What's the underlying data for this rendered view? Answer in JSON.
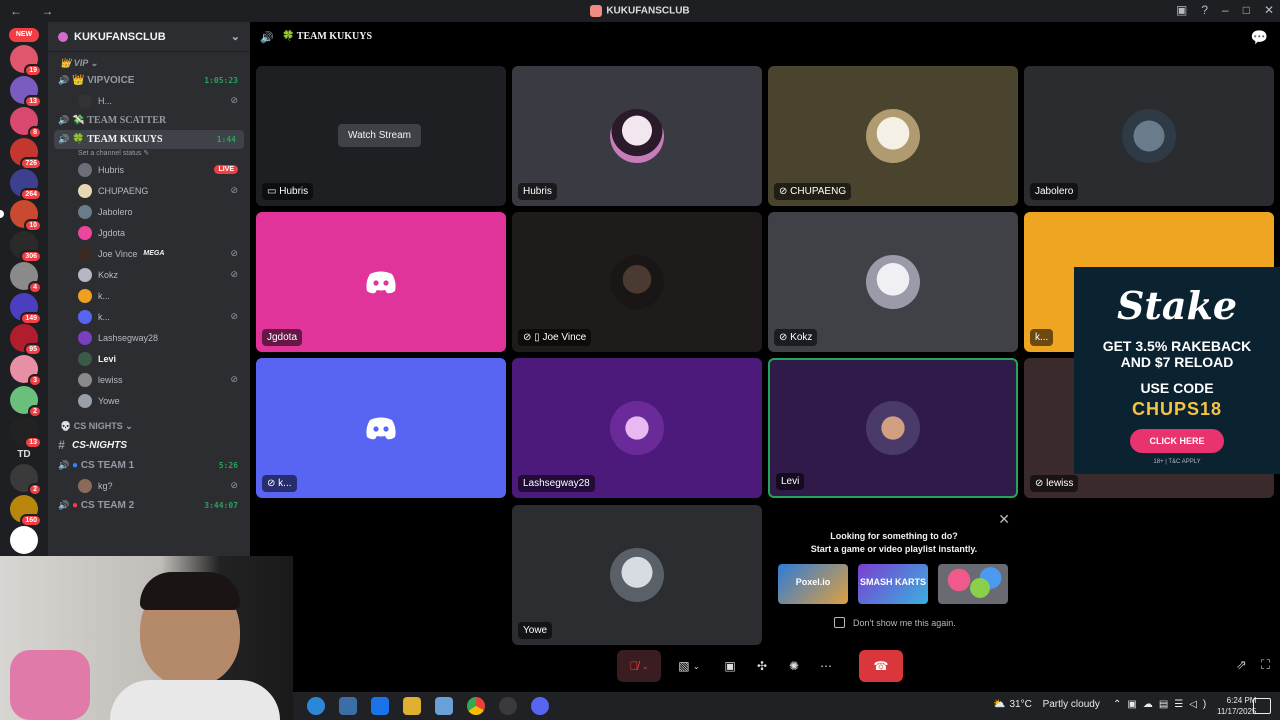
{
  "titlebar": {
    "title": "KUKUFANSCLUB",
    "nav": "←  →"
  },
  "guilds": [
    {
      "badge": "19",
      "color": "#e0566b"
    },
    {
      "badge": "13",
      "color": "#7a5cc0"
    },
    {
      "badge": "8",
      "color": "#d9486e"
    },
    {
      "badge": "726",
      "color": "#c4372f"
    },
    {
      "badge": "264",
      "color": "#3d3f8f"
    },
    {
      "badge": "10",
      "color": "#c94a2e"
    },
    {
      "badge": "306",
      "color": "#2a2a2a"
    },
    {
      "badge": "4",
      "color": "#8a8a8a"
    },
    {
      "badge": "149",
      "color": "#4b3fbf"
    },
    {
      "badge": "95",
      "color": "#b01e2e"
    },
    {
      "badge": "3",
      "color": "#e88fa6"
    },
    {
      "badge": "2",
      "color": "#6ac07a"
    },
    {
      "badge": "13",
      "color": "#222222"
    },
    {
      "badge": "2",
      "color": "#3a3a3a"
    },
    {
      "badge": "160",
      "color": "#b8860b"
    },
    {
      "badge": "",
      "color": "#ffffff"
    }
  ],
  "guild_new_label": "NEW",
  "guild_td_label": "TD",
  "server": {
    "name": "KUKUFANSCLUB"
  },
  "categories": {
    "vip": "VIP",
    "csnights": "CS NIGHTS",
    "csnights_channel": "CS-NIGHTS"
  },
  "channels": {
    "vipvoice": {
      "name": "VIPVOICE",
      "time": "1:05:23",
      "user": "H..."
    },
    "scatter": {
      "name": "TEAM SCATTER"
    },
    "kukuys": {
      "name": "TEAM KUKUYS",
      "time": "1:44",
      "status_hint": "Set a channel status"
    },
    "csteam1": {
      "name": "CS TEAM 1",
      "time": "5:26",
      "user": "kg?"
    },
    "csteam2": {
      "name": "CS TEAM 2",
      "time": "3:44:07"
    }
  },
  "members": [
    {
      "name": "Hubris",
      "live": "LIVE",
      "color": "#6d6f78"
    },
    {
      "name": "CHUPAENG",
      "color": "#e8d8b0"
    },
    {
      "name": "Jabolero",
      "color": "#6b7b8a"
    },
    {
      "name": "Jgdota",
      "color": "#eb459e"
    },
    {
      "name": "Joe Vince",
      "tag": "MEGA",
      "color": "#3a2a22"
    },
    {
      "name": "Kokz",
      "color": "#b7b7c4"
    },
    {
      "name": "k...",
      "color": "#f0a020"
    },
    {
      "name": "k...",
      "color": "#5865f2"
    },
    {
      "name": "Lashsegway28",
      "color": "#7a3fbf"
    },
    {
      "name": "Levi",
      "color": "#3a5a4a"
    },
    {
      "name": "lewiss",
      "color": "#8a8a8a"
    },
    {
      "name": "Yowe",
      "color": "#9aa0a8"
    }
  ],
  "header": {
    "channel": "TEAM KUKUYS"
  },
  "tiles": {
    "hubris_stream": {
      "label": "Hubris",
      "watch": "Watch Stream"
    },
    "hubris": {
      "label": "Hubris"
    },
    "chupaeng": {
      "label": "CHUPAENG"
    },
    "jabolero": {
      "label": "Jabolero"
    },
    "jgdota": {
      "label": "Jgdota"
    },
    "joevince": {
      "label": "Joe Vince"
    },
    "kokz": {
      "label": "Kokz"
    },
    "k_orange": {
      "label": "k..."
    },
    "k_blue": {
      "label": "k..."
    },
    "lashsegway": {
      "label": "Lashsegway28"
    },
    "levi": {
      "label": "Levi"
    },
    "lewiss": {
      "label": "lewiss"
    },
    "yowe": {
      "label": "Yowe"
    }
  },
  "ad": {
    "brand": "Stake",
    "line1": "GET 3.5% RAKEBACK",
    "line2": "AND $7 RELOAD",
    "line3": "USE CODE",
    "code": "CHUPS18",
    "cta": "CLICK HERE",
    "fine": "18+ | T&C APPLY"
  },
  "activity": {
    "title": "Looking for something to do?",
    "subtitle": "Start a game or video playlist instantly.",
    "games": [
      "Poxel.io",
      "SMASH KARTS",
      ""
    ],
    "dont_show": "Don't show me this again."
  },
  "taskbar": {
    "temp": "31°C",
    "weather": "Partly cloudy",
    "time": "6:24 PM",
    "date": "11/17/2025"
  },
  "colors": {
    "accent_green": "#23a55a",
    "live_red": "#f23f43",
    "jgdota_tile": "#e0349b",
    "k_orange_tile": "#f0a522",
    "k_blue_tile": "#5865f2",
    "lash_tile": "#4b1a7a",
    "levi_tile": "#2f1a4a"
  }
}
